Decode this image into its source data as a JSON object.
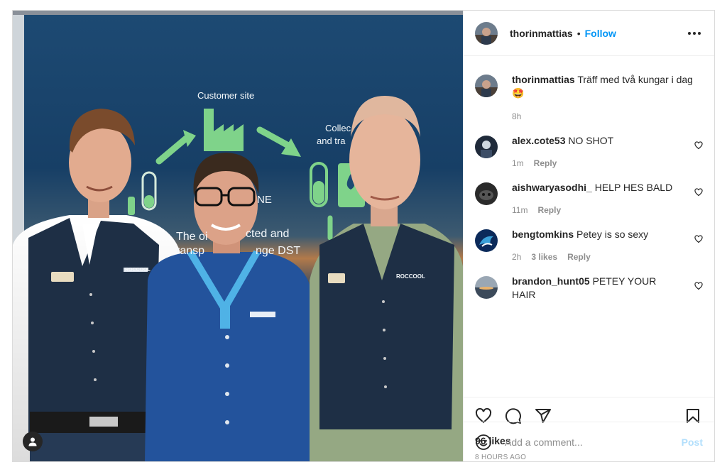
{
  "post": {
    "author": "thorinmattias",
    "follow_label": "Follow",
    "dot": "•",
    "caption": {
      "username": "thorinmattias",
      "text": "Träff med två kungar i dag 🤩",
      "time": "8h"
    },
    "comments": [
      {
        "username": "alex.cote53",
        "text": "NO SHOT",
        "time": "1m",
        "likes": "",
        "reply": "Reply"
      },
      {
        "username": "aishwaryasodhi_",
        "text": "HELP HES BALD",
        "time": "11m",
        "likes": "",
        "reply": "Reply"
      },
      {
        "username": "bengtomkins",
        "text": "Petey is so sexy",
        "time": "2h",
        "likes": "3 likes",
        "reply": "Reply"
      },
      {
        "username": "brandon_hunt05",
        "text": "PETEY YOUR HAIR",
        "time": "",
        "likes": "",
        "reply": ""
      }
    ],
    "likes_label": "96 likes",
    "posted_label": "8 HOURS AGO",
    "add_comment_placeholder": "Add a comment...",
    "post_button": "Post"
  },
  "photo_text": {
    "customer_site": "Customer site",
    "collect_1": "Collec",
    "collect_2": "and tra",
    "ne": "NE",
    "oil_1": "The oi",
    "oil_2": "cted and",
    "oil_3": "ransp",
    "oil_4": "nge DST",
    "vest_brand": "ROCCOOL"
  },
  "colors": {
    "accent": "#0095f6",
    "post_disabled": "#b2dffc",
    "banner_green": "#7fd38a",
    "banner_blue": "#12304f"
  },
  "icons": [
    "more-icon",
    "heart-icon",
    "comment-icon",
    "share-icon",
    "bookmark-icon",
    "emoji-icon",
    "person-icon"
  ]
}
